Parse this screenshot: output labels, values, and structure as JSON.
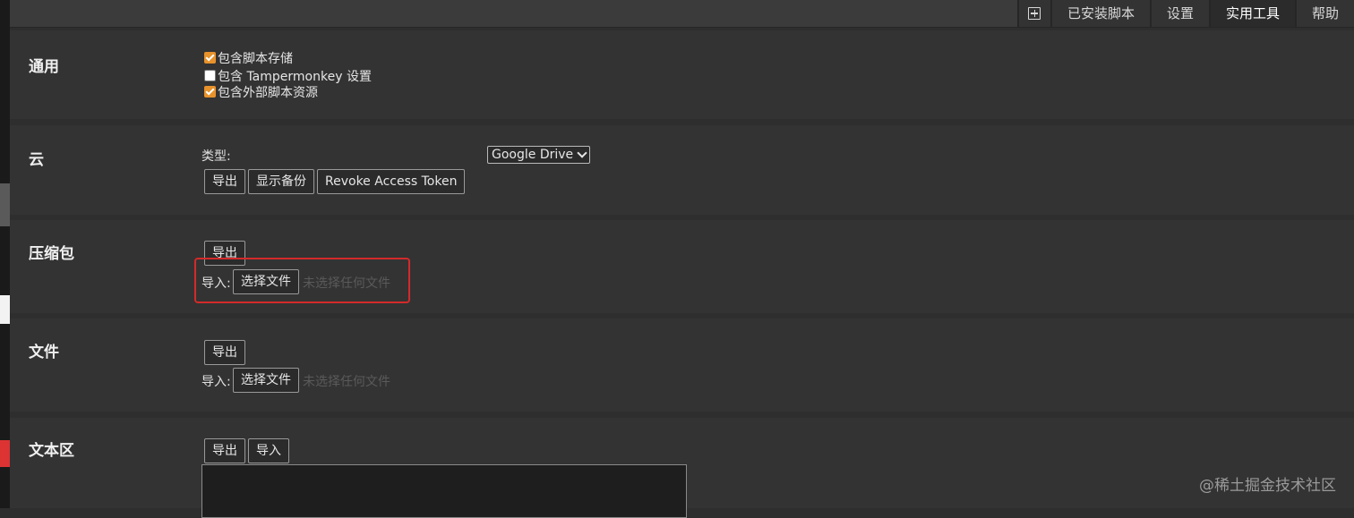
{
  "tabs": [
    {
      "label": "已安装脚本"
    },
    {
      "label": "设置"
    },
    {
      "label": "实用工具"
    },
    {
      "label": "帮助"
    }
  ],
  "general": {
    "title": "通用",
    "options": [
      {
        "label": "包含脚本存储",
        "checked": true
      },
      {
        "label": "包含 Tampermonkey 设置",
        "checked": false
      },
      {
        "label": "包含外部脚本资源",
        "checked": true
      }
    ]
  },
  "cloud": {
    "title": "云",
    "type_label": "类型:",
    "type_value": "Google Drive",
    "export_label": "导出",
    "show_backup_label": "显示备份",
    "revoke_label": "Revoke Access Token"
  },
  "zip": {
    "title": "压缩包",
    "export_label": "导出",
    "import_label": "导入:",
    "choose_file_label": "选择文件",
    "no_file_label": "未选择任何文件"
  },
  "file": {
    "title": "文件",
    "export_label": "导出",
    "import_label": "导入:",
    "choose_file_label": "选择文件",
    "no_file_label": "未选择任何文件"
  },
  "textarea_section": {
    "title": "文本区",
    "export_label": "导出",
    "import_label": "导入"
  },
  "watermark": "@稀土掘金技术社区",
  "colors": {
    "accent_orange": "#e8922b",
    "highlight_red": "#d42a2a",
    "background": "#2e2e2e"
  }
}
